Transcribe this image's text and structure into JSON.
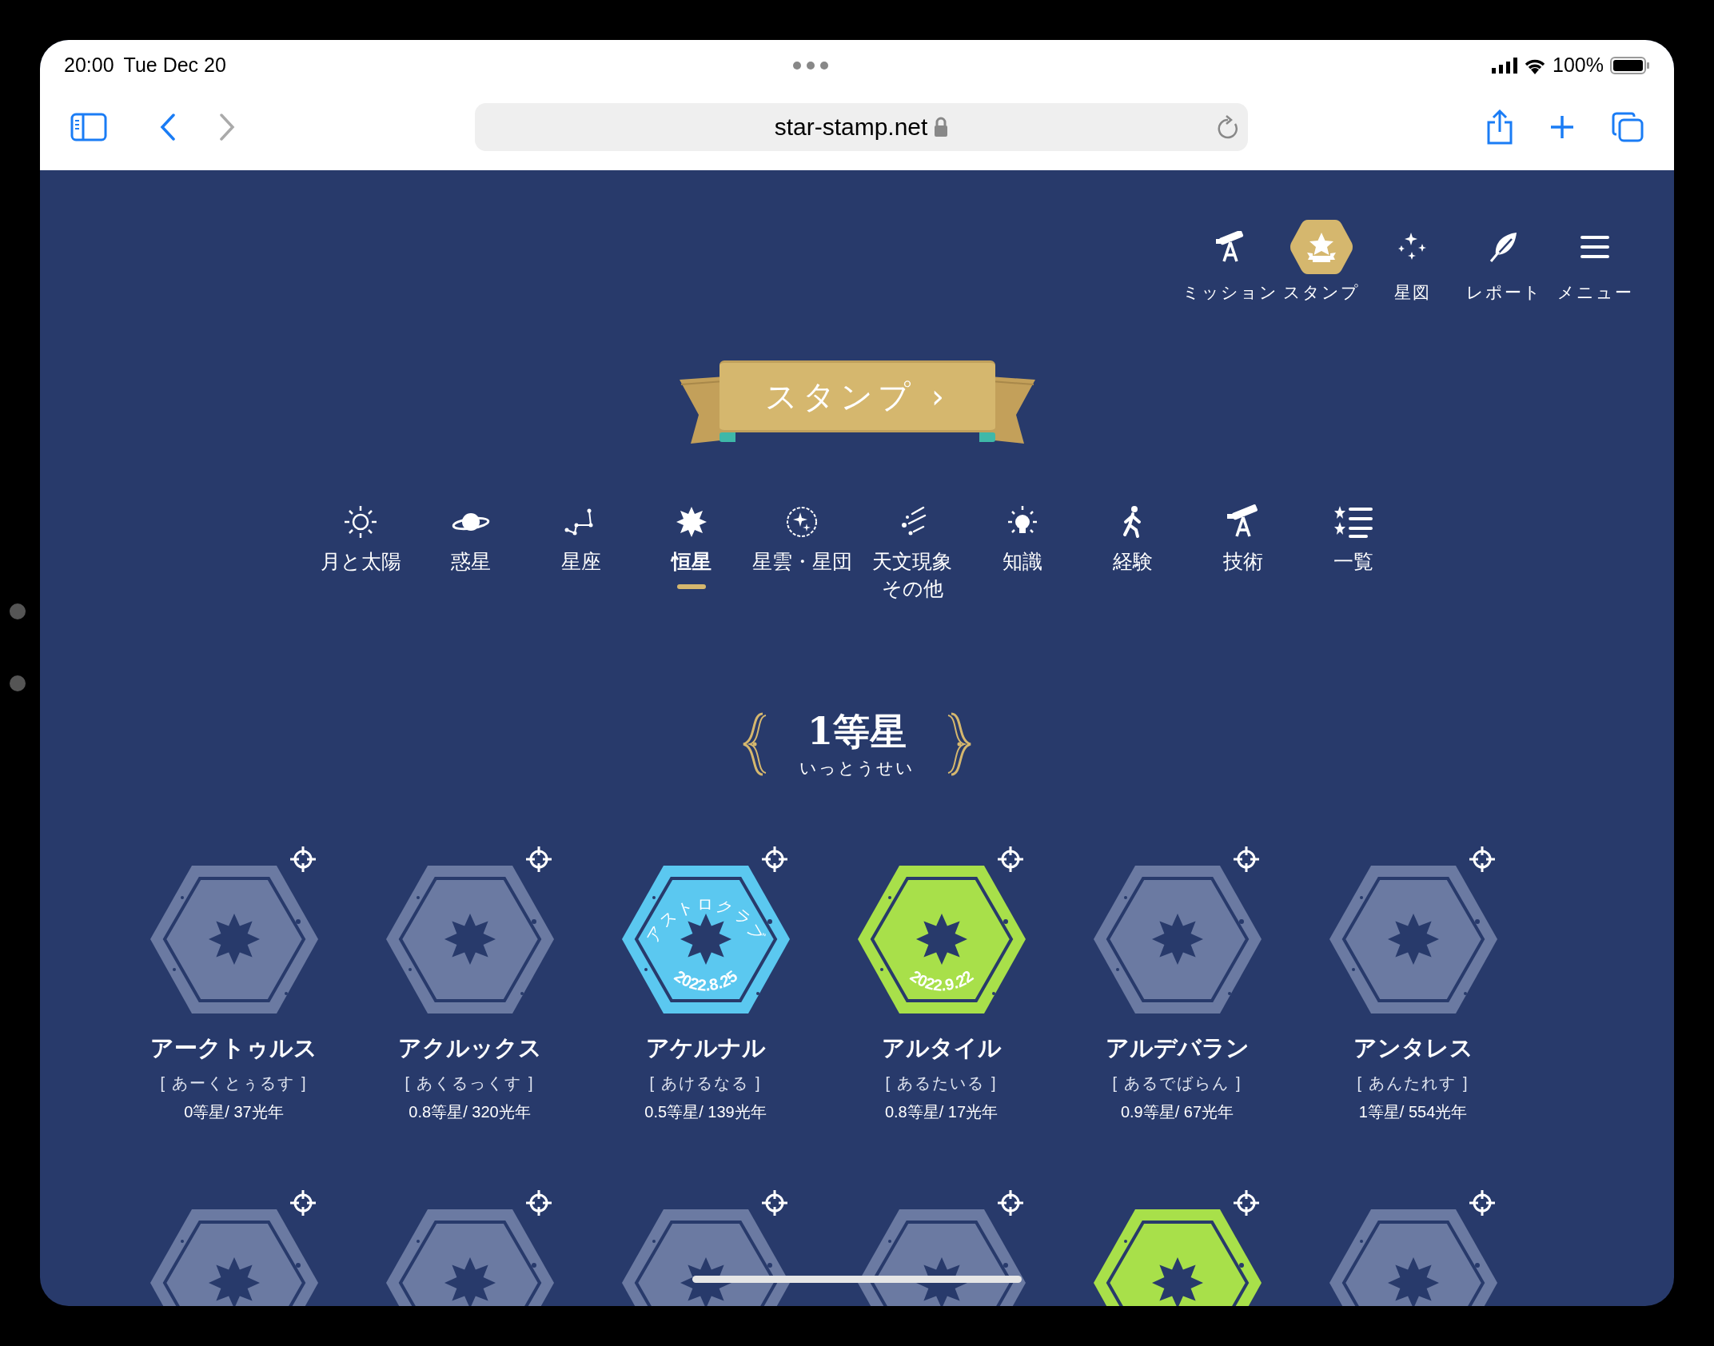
{
  "status_bar": {
    "time": "20:00",
    "date": "Tue Dec 20",
    "battery": "100%"
  },
  "browser": {
    "url": "star-stamp.net"
  },
  "nav": [
    {
      "label": "ミッション",
      "selected": false
    },
    {
      "label": "スタンプ",
      "selected": true
    },
    {
      "label": "星図",
      "selected": false
    },
    {
      "label": "レポート",
      "selected": false
    },
    {
      "label": "メニュー",
      "selected": false
    }
  ],
  "banner": {
    "label": "スタンプ",
    "arrow": "›"
  },
  "categories": [
    {
      "label": "月と太陽",
      "selected": false
    },
    {
      "label": "惑星",
      "selected": false
    },
    {
      "label": "星座",
      "selected": false
    },
    {
      "label": "恒星",
      "selected": true
    },
    {
      "label": "星雲・星団",
      "selected": false
    },
    {
      "label": "天文現象",
      "label_2": "その他",
      "selected": false
    },
    {
      "label": "知識",
      "selected": false
    },
    {
      "label": "経験",
      "selected": false
    },
    {
      "label": "技術",
      "selected": false
    },
    {
      "label": "一覧",
      "selected": false
    }
  ],
  "section": {
    "title": "1等星",
    "reading": "いっとうせい"
  },
  "stamps": [
    {
      "name": "アークトゥルス",
      "reading": "[ あーくとぅるす ]",
      "info": "0等星/ 37光年",
      "collected": false
    },
    {
      "name": "アクルックス",
      "reading": "[ あくるっくす ]",
      "info": "0.8等星/ 320光年",
      "collected": false
    },
    {
      "name": "アケルナル",
      "reading": "[ あけるなる ]",
      "info": "0.5等星/ 139光年",
      "collected": true,
      "color": "#5bc8f0",
      "arc_text": "アストロクラブ",
      "date": "2022.8.25"
    },
    {
      "name": "アルタイル",
      "reading": "[ あるたいる ]",
      "info": "0.8等星/ 17光年",
      "collected": true,
      "color": "#a8e04a",
      "date": "2022.9.22"
    },
    {
      "name": "アルデバラン",
      "reading": "[ あるでばらん ]",
      "info": "0.9等星/ 67光年",
      "collected": false
    },
    {
      "name": "アンタレス",
      "reading": "[ あんたれす ]",
      "info": "1等星/ 554光年",
      "collected": false
    }
  ],
  "stamps_row_2": [
    {
      "collected": false
    },
    {
      "collected": false
    },
    {
      "collected": false
    },
    {
      "collected": false
    },
    {
      "collected": true,
      "color": "#a8e04a"
    },
    {
      "collected": false
    }
  ]
}
